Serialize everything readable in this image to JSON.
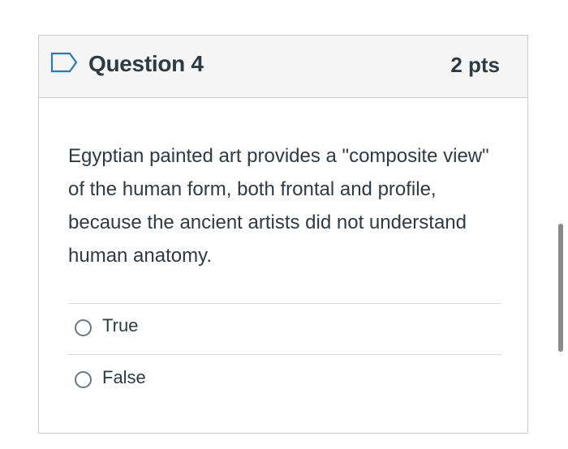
{
  "question": {
    "title": "Question 4",
    "points": "2 pts",
    "text": "Egyptian painted art provides a \"composite view\" of the human form, both frontal and profile, because the ancient artists did not understand human anatomy.",
    "flag_icon": "flag-outline-icon"
  },
  "answers": [
    {
      "label": "True",
      "selected": false
    },
    {
      "label": "False",
      "selected": false
    }
  ],
  "colors": {
    "text": "#2d3b45",
    "border": "#c7cdd1",
    "header_bg": "#f5f5f5",
    "flag_stroke": "#2b7abc"
  }
}
